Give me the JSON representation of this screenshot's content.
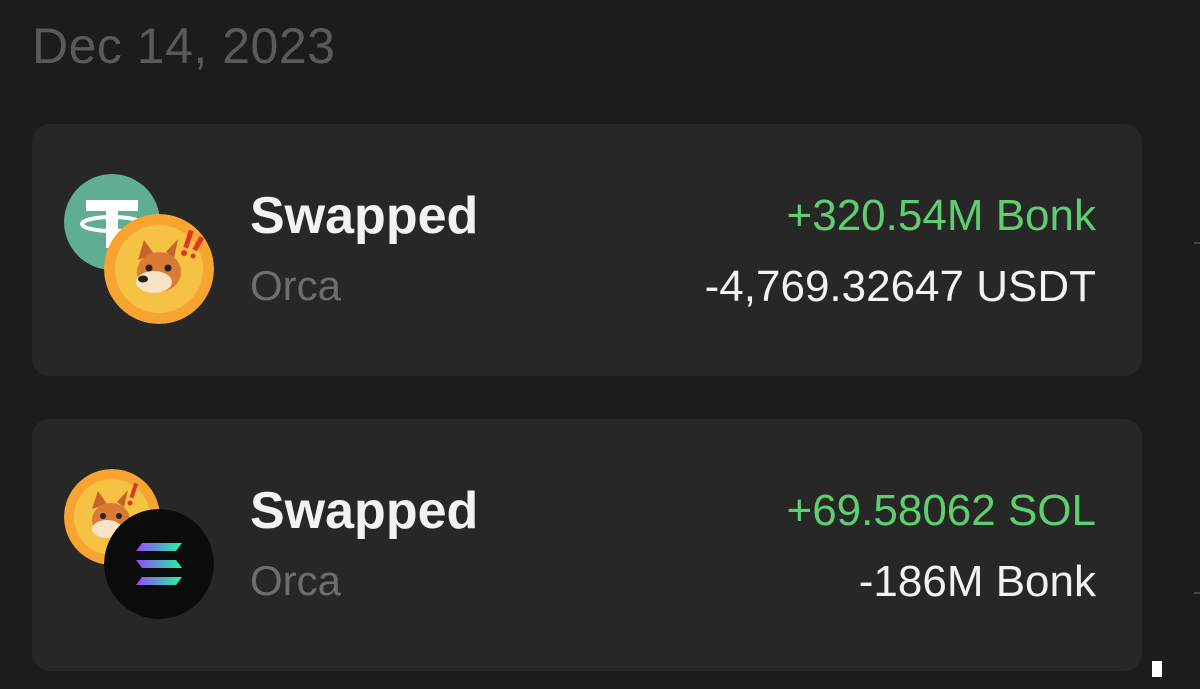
{
  "date_header": "Dec 14, 2023",
  "transactions": [
    {
      "title": "Swapped",
      "source": "Orca",
      "received": "+320.54M Bonk",
      "sent": "-4,769.32647 USDT",
      "icons": {
        "back": "usdt-token-icon",
        "front": "bonk-token-icon"
      }
    },
    {
      "title": "Swapped",
      "source": "Orca",
      "received": "+69.58062 SOL",
      "sent": "-186M Bonk",
      "icons": {
        "back": "bonk-token-icon",
        "front": "sol-token-icon"
      }
    }
  ],
  "colors": {
    "background": "#1c1c1c",
    "card": "#272727",
    "positive": "#5fce6f",
    "primary_text": "#f2f2f2",
    "secondary_text": "#6e6e6e",
    "usdt": "#5fae92",
    "bonk": "#f7a530",
    "sol_bg": "#0b0b0b"
  }
}
